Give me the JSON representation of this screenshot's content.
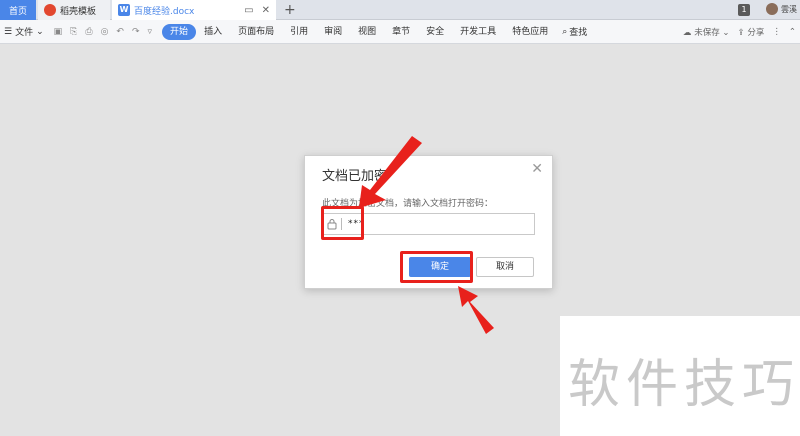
{
  "tabbar": {
    "home_label": "首页",
    "daoke_label": "稻壳模板",
    "doc_label": "百度经验.docx",
    "new_tab": "+",
    "page_count": "1",
    "user_name": "雲溪"
  },
  "toolbar": {
    "file_label": "文件",
    "tabs": [
      "开始",
      "插入",
      "页面布局",
      "引用",
      "审阅",
      "视图",
      "章节",
      "安全",
      "开发工具",
      "特色应用"
    ],
    "search_label": "查找",
    "unsaved_label": "未保存",
    "share_label": "分享"
  },
  "dialog": {
    "title": "文档已加密",
    "message": "此文档为加密文档，请输入文档打开密码：",
    "password_value": "***",
    "ok_label": "确定",
    "cancel_label": "取消"
  },
  "watermark": {
    "text": "软件技巧"
  },
  "colors": {
    "accent": "#4a86e8",
    "annotation": "#e8211c"
  }
}
